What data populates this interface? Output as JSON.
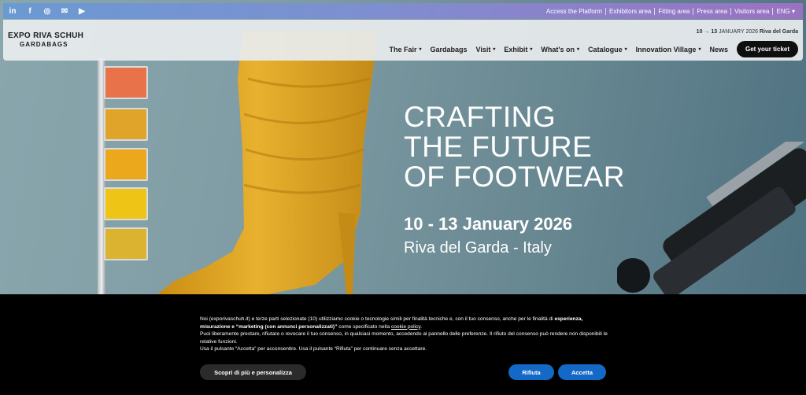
{
  "topbar": {
    "social": [
      {
        "name": "linkedin-icon",
        "glyph": "in"
      },
      {
        "name": "facebook-icon",
        "glyph": "f"
      },
      {
        "name": "instagram-icon",
        "glyph": "◎"
      },
      {
        "name": "wechat-icon",
        "glyph": "✉"
      },
      {
        "name": "youtube-icon",
        "glyph": "▶"
      }
    ],
    "links": [
      "Access the Platform",
      "Exhibitors area",
      "Fitting area",
      "Press area",
      "Visitors area"
    ],
    "language": "ENG"
  },
  "header": {
    "logo_line1": "EXPO RIVA SCHUH",
    "logo_line2": "GARDABAGS",
    "dates_prefix": "10 → 13",
    "dates_middle": " JANUARY 2026 ",
    "dates_place": "Riva del Garda",
    "nav": [
      {
        "label": "The Fair",
        "dropdown": true
      },
      {
        "label": "Gardabags",
        "dropdown": false
      },
      {
        "label": "Visit",
        "dropdown": true
      },
      {
        "label": "Exhibit",
        "dropdown": true
      },
      {
        "label": "What's on",
        "dropdown": true
      },
      {
        "label": "Catalogue",
        "dropdown": true
      },
      {
        "label": "Innovation Village",
        "dropdown": true
      },
      {
        "label": "News",
        "dropdown": false
      }
    ],
    "ticket_label": "Get your ticket"
  },
  "hero": {
    "title_line1": "CRAFTING",
    "title_line2": "THE FUTURE",
    "title_line3": "OF FOOTWEAR",
    "date": "10 - 13 January 2026",
    "place": "Riva del Garda - Italy",
    "swatch_colors": [
      "#e8734a",
      "#e0a42a",
      "#eba81c",
      "#eec516",
      "#dcb331"
    ],
    "boot_color": "#e3ac27"
  },
  "cookie": {
    "p1_a": "Noi (exporivaschuh.it) e terze parti selezionate (10) utilizziamo cookie o tecnologie simili per finalità tecniche e, con il tuo consenso, anche per le finalità di ",
    "p1_b": "esperienza, misurazione e “marketing (con annunci personalizzati)”",
    "p1_c": " come specificato nella ",
    "p1_link": "cookie policy",
    "p1_d": ".",
    "p2": "Puoi liberamente prestare, rifiutare o revocare il tuo consenso, in qualsiasi momento, accedendo al pannello delle preferenze. Il rifiuto del consenso può rendere non disponibili le relative funzioni.",
    "p3": "Usa il pulsante “Accetta” per acconsentire. Usa il pulsante “Rifiuta” per continuare senza accettare.",
    "more_label": "Scopri di più e personalizza",
    "reject_label": "Rifiuta",
    "accept_label": "Accetta"
  }
}
